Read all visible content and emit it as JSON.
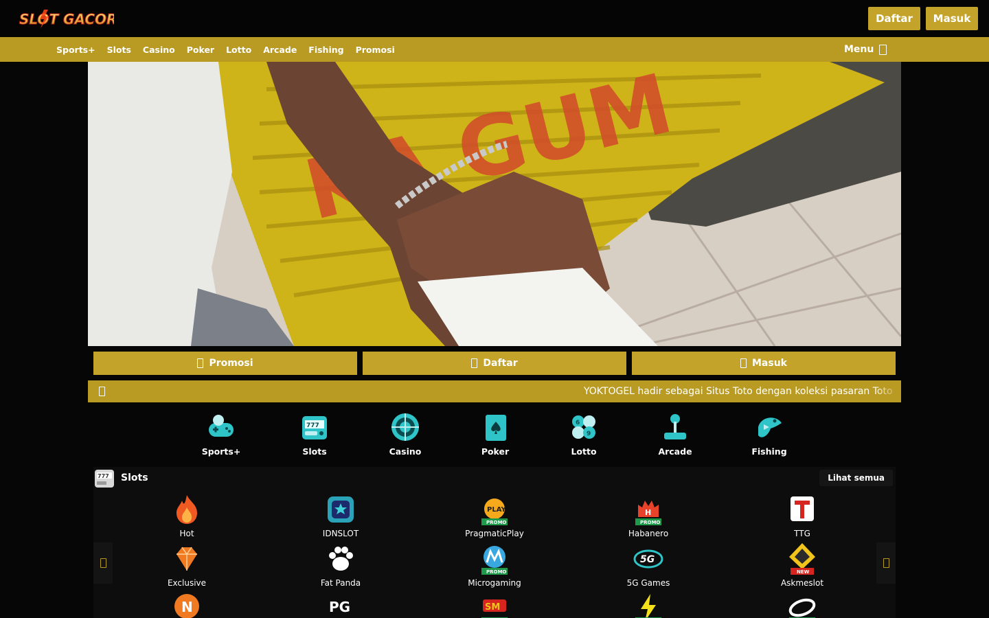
{
  "header": {
    "logo_text": "SLOT GACOR",
    "register_label": "Daftar",
    "login_label": "Masuk"
  },
  "nav": {
    "items": [
      "Sports+",
      "Slots",
      "Casino",
      "Poker",
      "Lotto",
      "Arcade",
      "Fishing",
      "Promosi"
    ],
    "menu_label": "Menu"
  },
  "banner": {
    "painted_text": "KA GUM"
  },
  "actions": {
    "promo_label": "Promosi",
    "register_label": "Daftar",
    "login_label": "Masuk"
  },
  "ticker": {
    "text": "YOKTOGEL hadir sebagai Situs Toto dengan koleksi pasaran Toto"
  },
  "categories": [
    {
      "label": "Sports+",
      "icon": "sports-gamepad-icon"
    },
    {
      "label": "Slots",
      "icon": "slot-machine-icon"
    },
    {
      "label": "Casino",
      "icon": "roulette-icon"
    },
    {
      "label": "Poker",
      "icon": "playing-card-icon"
    },
    {
      "label": "Lotto",
      "icon": "lotto-balls-icon"
    },
    {
      "label": "Arcade",
      "icon": "joystick-icon"
    },
    {
      "label": "Fishing",
      "icon": "fish-icon"
    }
  ],
  "slots_panel": {
    "title": "Slots",
    "see_all_label": "Lihat semua",
    "games": [
      {
        "label": "Hot",
        "icon": "fire-icon",
        "badge": ""
      },
      {
        "label": "IDNSLOT",
        "icon": "idnslot-icon",
        "badge": ""
      },
      {
        "label": "PragmaticPlay",
        "icon": "pragmatic-play-icon",
        "badge": "PROMO"
      },
      {
        "label": "Habanero",
        "icon": "habanero-icon",
        "badge": "PROMO"
      },
      {
        "label": "TTG",
        "icon": "ttg-icon",
        "badge": ""
      },
      {
        "label": "Exclusive",
        "icon": "diamond-icon",
        "badge": ""
      },
      {
        "label": "Fat Panda",
        "icon": "paw-icon",
        "badge": ""
      },
      {
        "label": "Microgaming",
        "icon": "microgaming-icon",
        "badge": "PROMO"
      },
      {
        "label": "5G Games",
        "icon": "5g-games-icon",
        "badge": ""
      },
      {
        "label": "Askmeslot",
        "icon": "askmeslot-icon",
        "badge": "NEW"
      },
      {
        "label": "",
        "icon": "n-logo-icon",
        "badge": ""
      },
      {
        "label": "",
        "icon": "pg-soft-icon",
        "badge": ""
      },
      {
        "label": "",
        "icon": "spade-gaming-icon",
        "badge": ""
      },
      {
        "label": "",
        "icon": "lightning-icon",
        "badge": ""
      },
      {
        "label": "",
        "icon": "swirl-logo-icon",
        "badge": ""
      }
    ]
  },
  "colors": {
    "accent": "#c4a32a",
    "nav_bg": "#b99b24",
    "page_bg": "#060606",
    "icon_teal": "#2ec4c8"
  }
}
